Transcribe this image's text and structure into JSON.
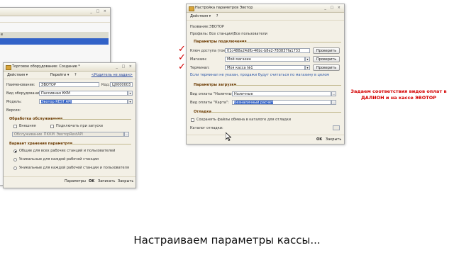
{
  "bg_window": {
    "title": "",
    "header_label": "е"
  },
  "equipment_window": {
    "title": "Торговое оборудование: Создание *",
    "toolbar": {
      "actions": "Действия ▾",
      "goto": "Перейти ▾",
      "help": "?",
      "parent_link": "<Родитель не задан>"
    },
    "fields": {
      "name_label": "Наименование:",
      "name_value": "ЭВОТОР",
      "code_label": "Код:",
      "code_value": "Ц0000003",
      "type_label": "Вид оборудования:",
      "type_value": "Пассивная ККМ",
      "model_label": "Модель:",
      "model_value": "Эвотор REST API",
      "version_label": "Версия:"
    },
    "section_processing": "Обработка обслуживания",
    "cb_external": "Внешняя",
    "cb_autoconnect": "Подключать при запуске",
    "processing_value": "Обслуживание_ПККМ_ЭвоторRestAPI",
    "section_storage": "Вариант хранения параметров",
    "radio_1": "Общие для всех рабочих станций и пользователей",
    "radio_2": "Уникальные для каждой рабочей станции",
    "radio_3": "Уникальные для каждой рабочей станции и пользователя",
    "footer": {
      "params": "Параметры",
      "ok": "OK",
      "save": "Записать",
      "close": "Закрыть"
    }
  },
  "settings_window": {
    "title": "Настройка параметров Эвотор",
    "toolbar": {
      "actions": "Действия ▾",
      "help": "?"
    },
    "name_label": "Название:",
    "name_value": "ЭВОТОР",
    "profile_label": "Профиль:",
    "profile_value": "Все станции\\Все пользователи",
    "section_connection": "Параметры подключения",
    "token_label": "Ключ доступа (токен):",
    "token_value": "01c488a24dfb-46bc-b8e2-783837fa1733",
    "store_label": "Магазин:",
    "store_value": "Мой магазин",
    "terminal_label": "Терминал:",
    "terminal_value": "Моя касса №1",
    "check_button": "Проверить",
    "hint": "Если терминал не указан, продажи будут считаться по магазину в целом",
    "section_load": "Параметры загрузки",
    "cash_label": "Вид оплаты \"Наличные\":",
    "cash_value": "Наличные",
    "card_label": "Вид оплаты \"Карта\":",
    "card_value": "Безналичный расчет",
    "section_unload": "Отладка",
    "save_files_label": "Сохранять файлы обмена в каталоге для отладки",
    "catalog_label": "Каталог отладки:",
    "footer": {
      "ok": "OK",
      "close": "Закрыть"
    }
  },
  "annotation": {
    "line1": "Задаем соответствия видов оплат в",
    "line2": "ДАЛИОН и на кассе ЭВОТОР"
  },
  "caption": "Настраиваем параметры кассы...",
  "colors": {
    "accent_red": "#d40000",
    "selection": "#3262c8",
    "window_bg": "#f3f0e6"
  }
}
